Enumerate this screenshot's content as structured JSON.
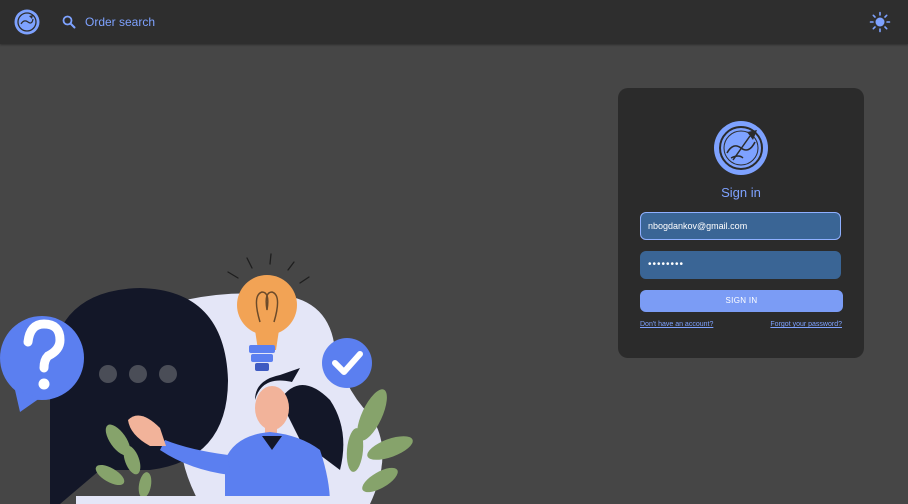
{
  "header": {
    "search_label": "Order search",
    "logo_icon": "compass-globe-logo",
    "search_icon": "search-icon",
    "theme_icon": "sun-icon"
  },
  "login": {
    "title": "Sign in",
    "email_value": "nbogdankov@gmail.com",
    "password_value": "••••••••",
    "signin_label": "SIGN IN",
    "signup_link": "Don't have an account?",
    "forgot_link": "Forgot your password?"
  },
  "colors": {
    "accent": "#7ea2ff",
    "background": "#464646",
    "topbar": "#2e2e2e",
    "card": "#2b2b2b",
    "field": "#3a6595",
    "button": "#7b9cf5"
  }
}
